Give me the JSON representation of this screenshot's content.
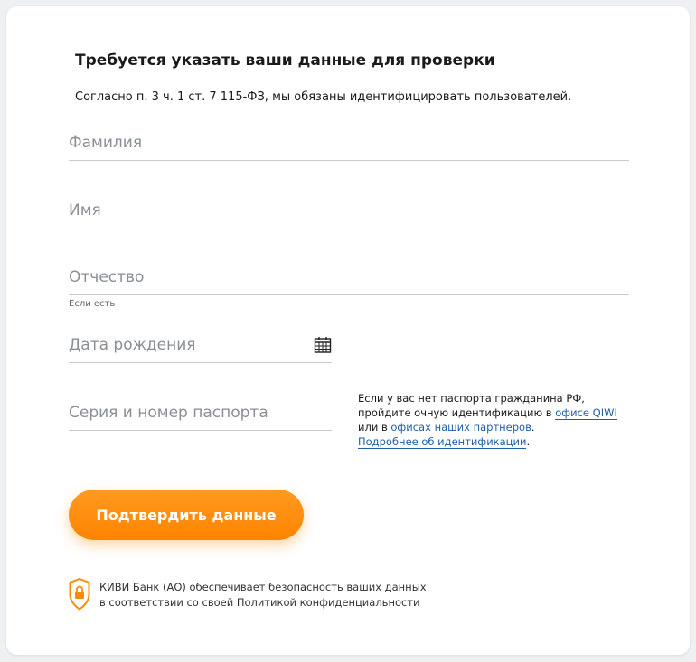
{
  "form": {
    "title": "Требуется указать ваши данные для проверки",
    "subtitle": "Согласно п. 3 ч. 1 ст. 7 115-ФЗ, мы обязаны идентифицировать пользователей.",
    "last_name": {
      "placeholder": "Фамилия",
      "value": ""
    },
    "first_name": {
      "placeholder": "Имя",
      "value": ""
    },
    "patronymic": {
      "placeholder": "Отчество",
      "value": "",
      "hint": "Если есть"
    },
    "birth_date": {
      "placeholder": "Дата рождения",
      "value": "",
      "icon": "calendar-icon"
    },
    "passport": {
      "placeholder": "Серия и номер паспорта",
      "value": ""
    }
  },
  "info": {
    "text_1": "Если у вас нет паспорта гражданина РФ, пройдите очную идентификацию в ",
    "link_office": "офисе QIWI",
    "text_2": " или в ",
    "link_partners": "офисах наших партнеров",
    "text_3": ".",
    "link_more": "Подробнее об идентификации",
    "text_4": "."
  },
  "submit": {
    "label": "Подтвердить данные"
  },
  "footer": {
    "icon": "shield-lock-icon",
    "line1": "КИВИ Банк (АО) обеспечивает безопасность ваших данных",
    "line2": "в соответствии со своей Политикой конфиденциальности"
  },
  "colors": {
    "accent": "#ff8c00",
    "link": "#1f5fa8",
    "background": "#eef0f2",
    "card": "#ffffff"
  }
}
